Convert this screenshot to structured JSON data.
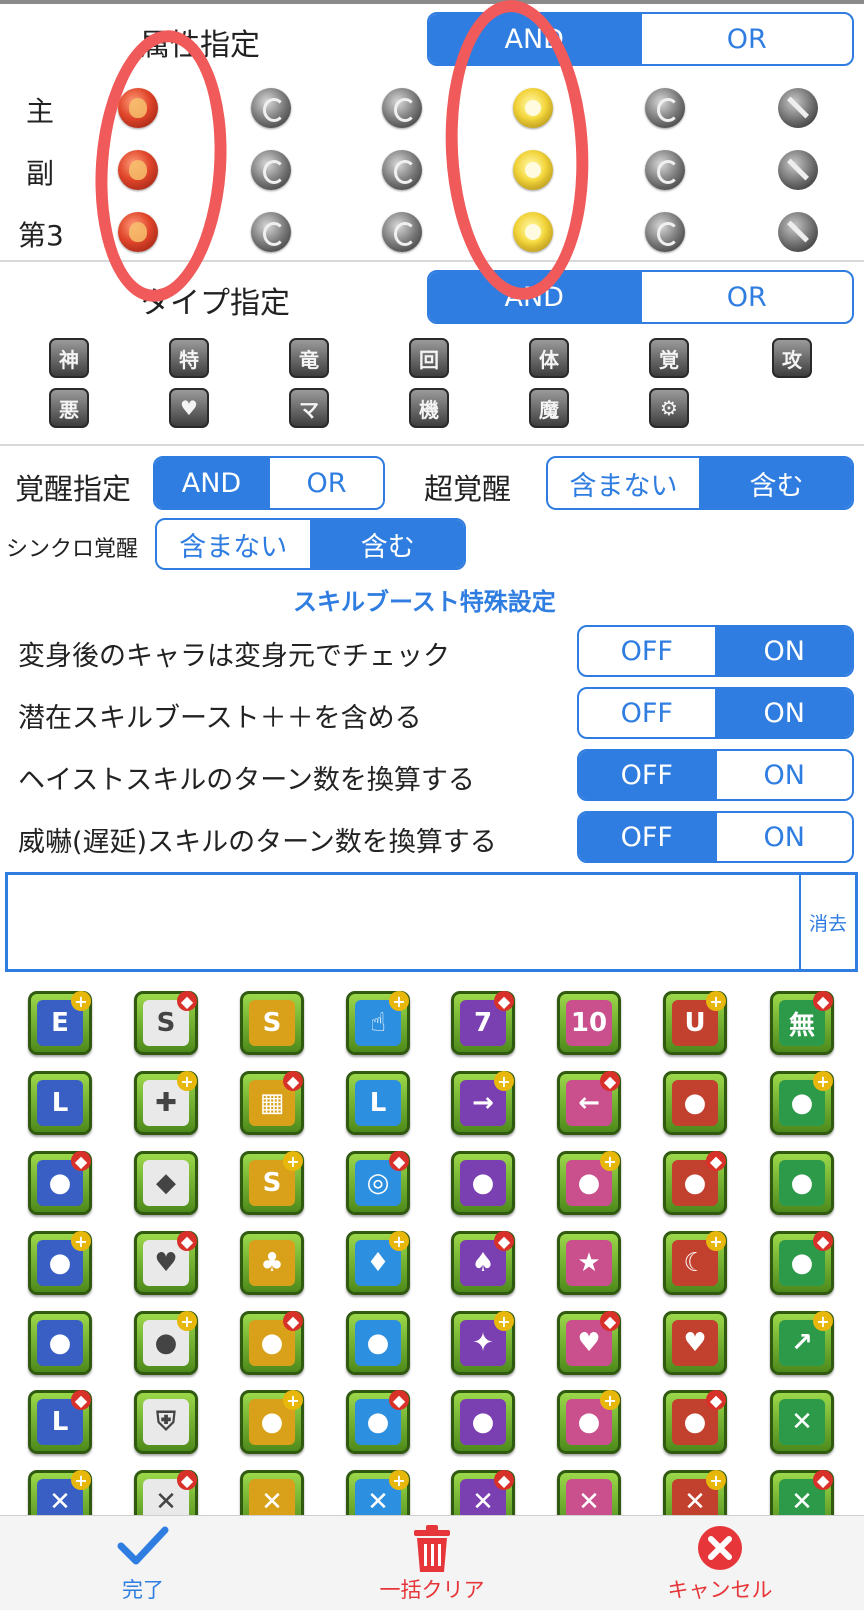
{
  "attribute": {
    "heading": "属性指定",
    "toggle": {
      "and": "AND",
      "or": "OR",
      "selected": "AND"
    },
    "rows": [
      "主",
      "副",
      "第3"
    ],
    "orbs": [
      "fire-orb",
      "water-orb",
      "wood-orb",
      "light-orb",
      "dark-orb",
      "no-attribute"
    ]
  },
  "type": {
    "heading": "タイプ指定",
    "toggle": {
      "and": "AND",
      "or": "OR",
      "selected": "AND"
    },
    "icons_row1": [
      "神",
      "特",
      "竜",
      "回",
      "体",
      "覚",
      "攻"
    ],
    "icons_row2": [
      "悪",
      "♥",
      "マ",
      "機",
      "魔",
      "⚙"
    ]
  },
  "awakening": {
    "label": "覚醒指定",
    "toggle": {
      "and": "AND",
      "or": "OR",
      "selected": "AND"
    },
    "super_label": "超覚醒",
    "super_toggle": {
      "exclude": "含まない",
      "include": "含む",
      "selected": "含む"
    },
    "sync_label": "シンクロ覚醒",
    "sync_toggle": {
      "exclude": "含まない",
      "include": "含む",
      "selected": "含む"
    }
  },
  "skill_boost_link": "スキルブースト特殊設定",
  "settings": [
    {
      "label": "変身後のキャラは変身元でチェック",
      "off": "OFF",
      "on": "ON",
      "selected": "ON"
    },
    {
      "label": "潜在スキルブースト＋＋を含める",
      "off": "OFF",
      "on": "ON",
      "selected": "ON"
    },
    {
      "label": "ヘイストスキルのターン数を換算する",
      "off": "OFF",
      "on": "ON",
      "selected": "OFF"
    },
    {
      "label": "威嚇(遅延)スキルのターン数を換算する",
      "off": "OFF",
      "on": "ON",
      "selected": "OFF"
    }
  ],
  "search": {
    "value": "",
    "clear_label": "消去"
  },
  "awakening_icons": [
    "equip-E",
    "skill-boost-plus",
    "skill-boost-minus",
    "cursor-plus",
    "7c-combo",
    "10c-combo",
    "bounce",
    "guard-break",
    "l-shape-attack",
    "cross-attack",
    "rainbow-board",
    "l-lock",
    "left-right-attack",
    "right-left-attack",
    "3-color",
    "5-color",
    "4-color",
    "orb-break",
    "skill-boost-team",
    "damage-reduction",
    "fire-plus",
    "water-plus",
    "wood-plus",
    "light-plus",
    "dark-plus",
    "heart-plus",
    "fire-row",
    "water-row",
    "wood-row",
    "light-row",
    "dark-row",
    "fire-combo",
    "water-combo",
    "wood-combo",
    "light-combo",
    "dark-combo",
    "sparkle",
    "team-heal",
    "team-rcv",
    "crit-up",
    "l-attack",
    "guard",
    "fire-resist",
    "water-resist",
    "wood-resist",
    "light-resist",
    "dark-resist",
    "jammer-resist",
    "poison-resist",
    "bind-resist",
    "blind-resist",
    "cloud-resist",
    "tape-resist",
    "dragon-killer",
    "attack-killer",
    "god-killer"
  ],
  "toolbar": {
    "done": "完了",
    "clear_all": "一括クリア",
    "cancel": "キャンセル"
  },
  "colors": {
    "accent": "#2f7de1",
    "annotation": "#f05a5a",
    "danger": "#e6363a"
  }
}
